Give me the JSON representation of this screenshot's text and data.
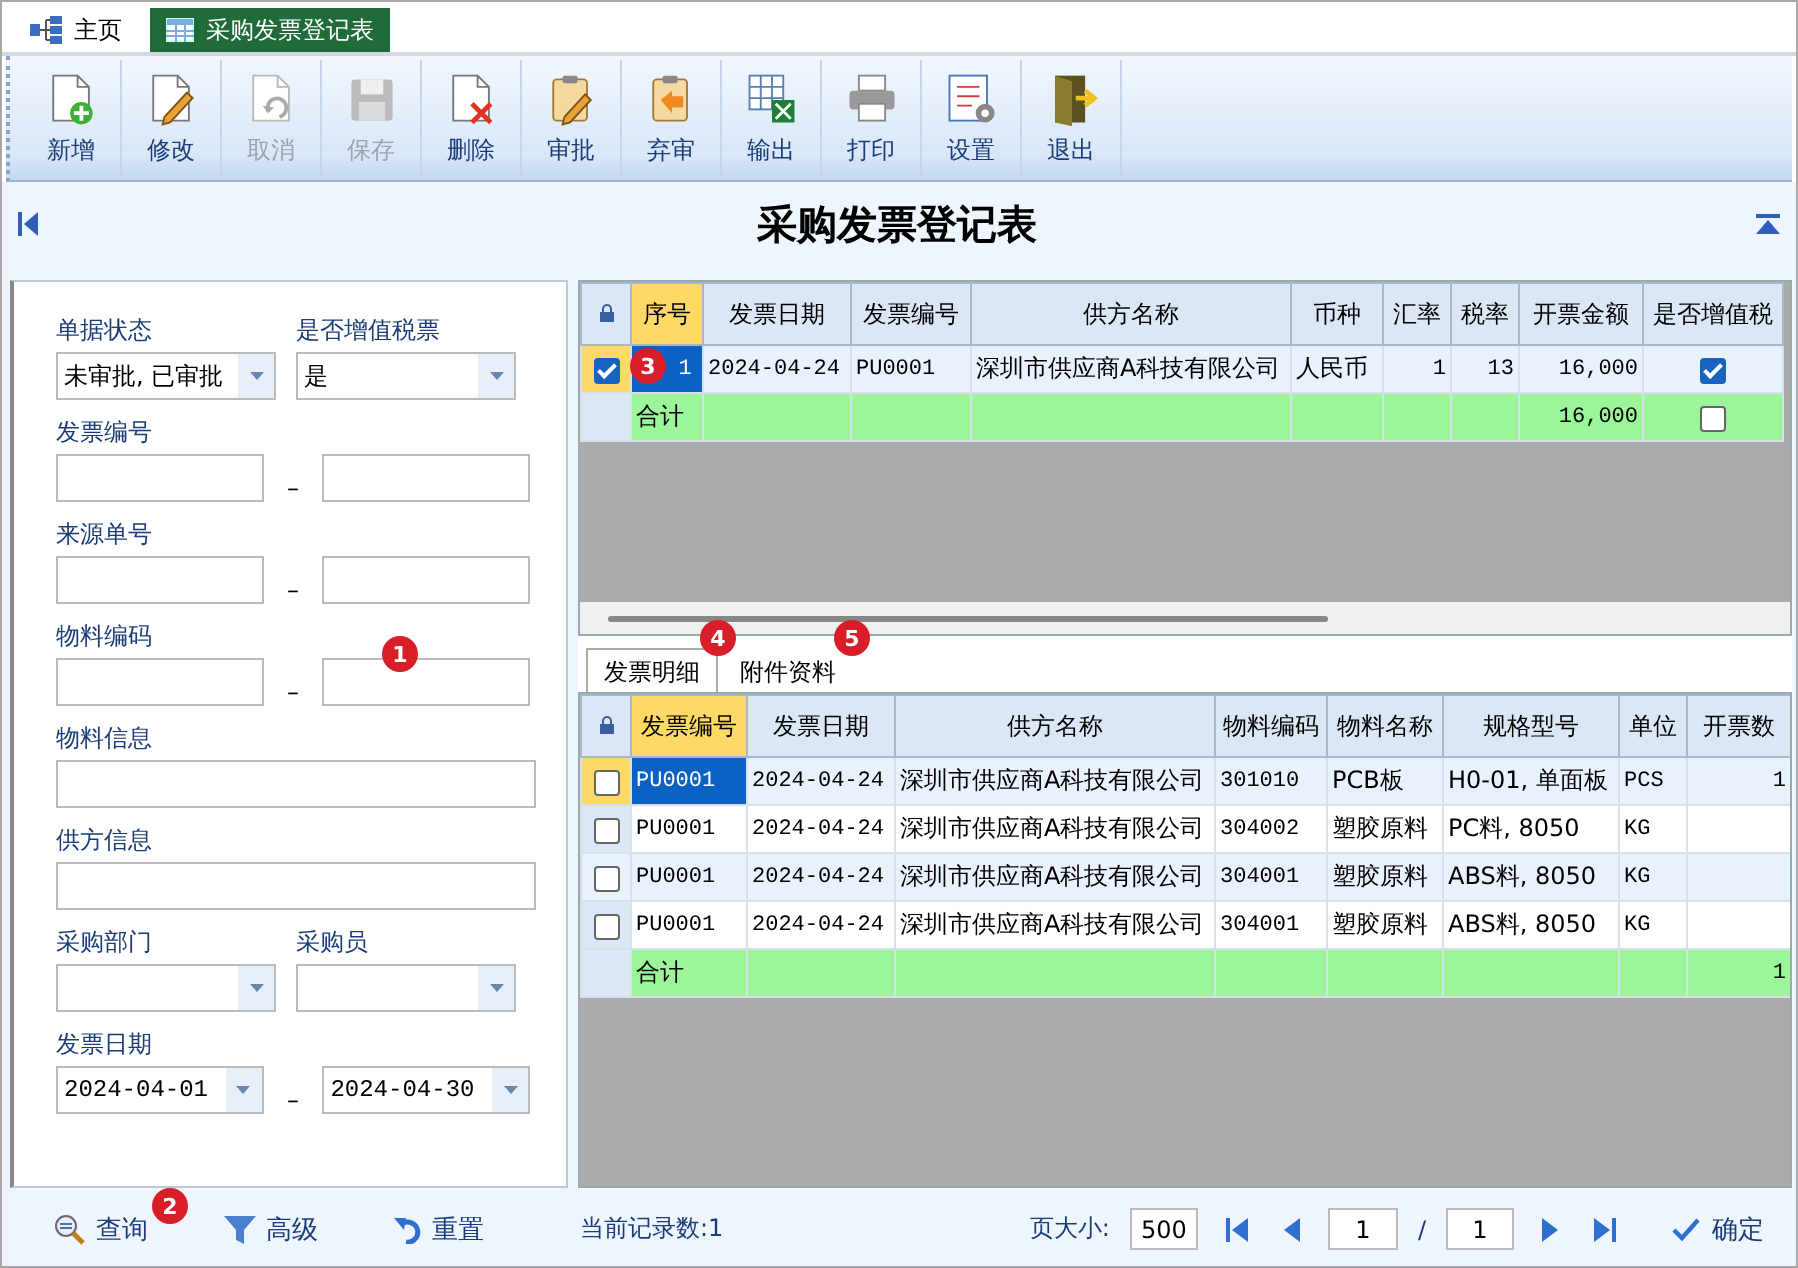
{
  "tabs": [
    {
      "label": "主页",
      "kind": "home",
      "selected": false
    },
    {
      "label": "采购发票登记表",
      "kind": "sheet",
      "selected": true
    }
  ],
  "toolbar": [
    {
      "label": "新增",
      "kind": "new",
      "disabled": false
    },
    {
      "label": "修改",
      "kind": "edit",
      "disabled": false
    },
    {
      "label": "取消",
      "kind": "undo",
      "disabled": true
    },
    {
      "label": "保存",
      "kind": "save",
      "disabled": true
    },
    {
      "label": "删除",
      "kind": "delete",
      "disabled": false
    },
    {
      "label": "审批",
      "kind": "approve",
      "disabled": false
    },
    {
      "label": "弃审",
      "kind": "unapprove",
      "disabled": false
    },
    {
      "label": "输出",
      "kind": "export",
      "disabled": false
    },
    {
      "label": "打印",
      "kind": "print",
      "disabled": false
    },
    {
      "label": "设置",
      "kind": "settings",
      "disabled": false
    },
    {
      "label": "退出",
      "kind": "exit",
      "disabled": false
    }
  ],
  "title": "采购发票登记表",
  "filters": [
    {
      "kind": "pair",
      "fields": [
        {
          "label": "单据状态",
          "value": "未审批, 已审批",
          "dropdown": true
        },
        {
          "label": "是否增值税票",
          "value": "是",
          "dropdown": true
        }
      ]
    },
    {
      "kind": "range",
      "label": "发票编号",
      "separator": "–",
      "from": {
        "dropdown": false
      },
      "to": {
        "dropdown": false
      }
    },
    {
      "kind": "range",
      "label": "来源单号",
      "separator": "–",
      "from": {
        "dropdown": false
      },
      "to": {
        "dropdown": false
      }
    },
    {
      "kind": "range",
      "label": "物料编码",
      "separator": "–",
      "from": {
        "dropdown": false
      },
      "to": {
        "dropdown": false
      }
    },
    {
      "kind": "single",
      "label": "物料信息"
    },
    {
      "kind": "single",
      "label": "供方信息"
    },
    {
      "kind": "pair",
      "fields": [
        {
          "label": "采购部门",
          "dropdown": true
        },
        {
          "label": "采购员",
          "dropdown": true
        }
      ]
    },
    {
      "kind": "range",
      "label": "发票日期",
      "separator": "–",
      "from": {
        "value": "2024-04-01",
        "dropdown": true
      },
      "to": {
        "value": "2024-04-30",
        "dropdown": true
      }
    }
  ],
  "actions": [
    {
      "label": "查询",
      "kind": "search"
    },
    {
      "label": "高级",
      "kind": "filter"
    },
    {
      "label": "重置",
      "kind": "reset"
    }
  ],
  "record_count": "当前记录数:1",
  "pager": {
    "size_label": "页大小:",
    "size": "500",
    "page": "1",
    "slash": "/",
    "total": "1",
    "confirm": "确定"
  },
  "invoice_table": {
    "columns": [
      {
        "label": "序号",
        "current": true
      },
      {
        "label": "发票日期",
        "current": false
      },
      {
        "label": "发票编号",
        "current": false
      },
      {
        "label": "供方名称",
        "current": false
      },
      {
        "label": "币种",
        "current": false
      },
      {
        "label": "汇率",
        "current": false
      },
      {
        "label": "税率",
        "current": false
      },
      {
        "label": "开票金额",
        "current": false
      },
      {
        "label": "是否增值税",
        "current": false
      }
    ],
    "rows": [
      {
        "selected": true,
        "checked": true,
        "cells": [
          "1",
          "2024-04-24",
          "PU0001",
          "深圳市供应商A科技有限公司",
          "人民币",
          "1",
          "13",
          "16,000"
        ],
        "vat": true
      }
    ],
    "total": {
      "label": "合计",
      "amount": "16,000",
      "vat": false
    }
  },
  "detail_tabs": [
    {
      "label": "发票明细",
      "selected": true
    },
    {
      "label": "附件资料",
      "selected": false
    }
  ],
  "detail_table": {
    "columns": [
      {
        "label": "发票编号",
        "current": true
      },
      {
        "label": "发票日期",
        "current": false
      },
      {
        "label": "供方名称",
        "current": false
      },
      {
        "label": "物料编码",
        "current": false
      },
      {
        "label": "物料名称",
        "current": false
      },
      {
        "label": "规格型号",
        "current": false
      },
      {
        "label": "单位",
        "current": false
      },
      {
        "label": "开票数",
        "current": false
      }
    ],
    "rows": [
      {
        "selected": true,
        "checked": false,
        "cells": [
          "PU0001",
          "2024-04-24",
          "深圳市供应商A科技有限公司",
          "301010",
          "PCB板",
          "H0-01, 单面板",
          "PCS",
          "1"
        ]
      },
      {
        "selected": false,
        "checked": false,
        "cells": [
          "PU0001",
          "2024-04-24",
          "深圳市供应商A科技有限公司",
          "304002",
          "塑胶原料",
          "PC料, 8050",
          "KG"
        ]
      },
      {
        "selected": false,
        "checked": false,
        "cells": [
          "PU0001",
          "2024-04-24",
          "深圳市供应商A科技有限公司",
          "304001",
          "塑胶原料",
          "ABS料, 8050",
          "KG"
        ]
      },
      {
        "selected": false,
        "checked": false,
        "cells": [
          "PU0001",
          "2024-04-24",
          "深圳市供应商A科技有限公司",
          "304001",
          "塑胶原料",
          "ABS料, 8050",
          "KG"
        ]
      }
    ],
    "total": {
      "label": "合计",
      "quantity": "1"
    }
  },
  "markers": [
    {
      "text": "1"
    },
    {
      "text": "2"
    },
    {
      "text": "3"
    },
    {
      "text": "4"
    },
    {
      "text": "5"
    }
  ]
}
